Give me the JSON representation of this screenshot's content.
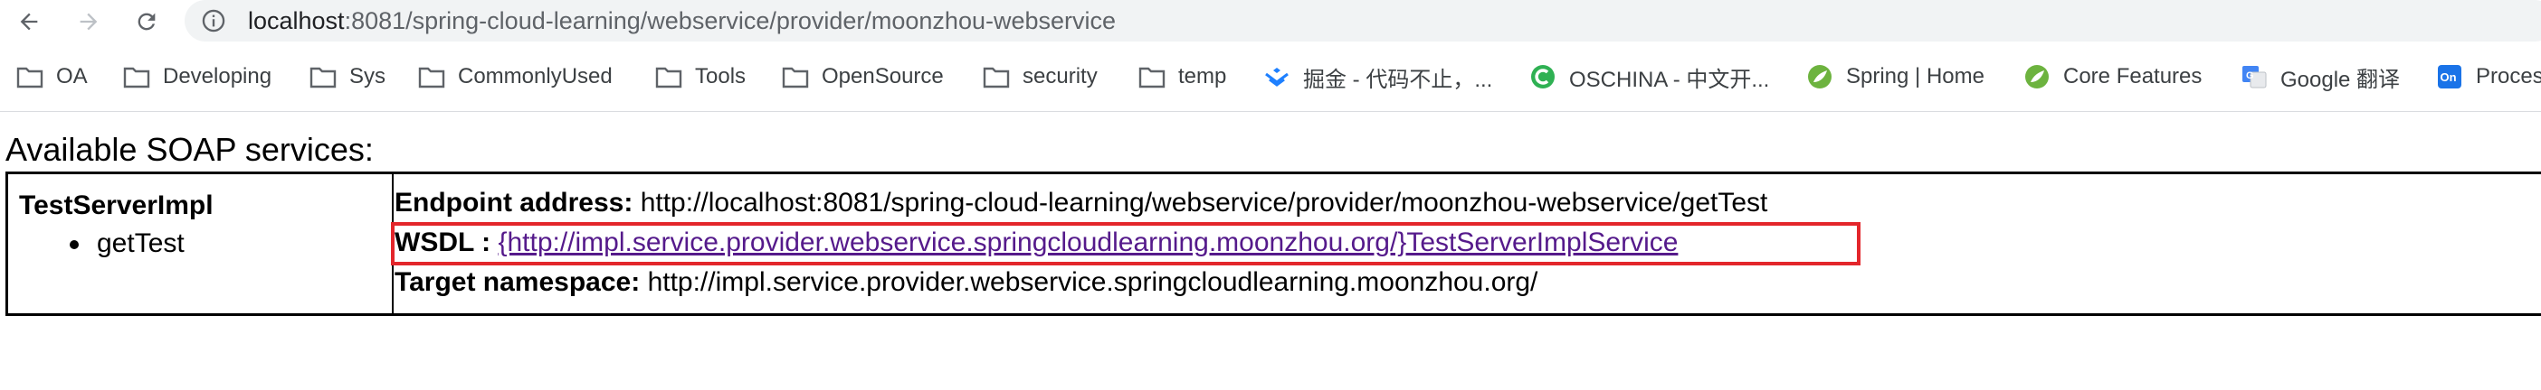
{
  "browser": {
    "url_host": "localhost",
    "url_path": ":8081/spring-cloud-learning/webservice/provider/moonzhou-webservice",
    "nav": {
      "back_icon": "arrow-left-icon",
      "forward_icon": "arrow-right-icon",
      "reload_icon": "reload-icon",
      "info_icon": "info-icon"
    },
    "bookmarks": [
      {
        "label": "OA",
        "icon": "folder-icon"
      },
      {
        "label": "Developing",
        "icon": "folder-icon"
      },
      {
        "label": "Sys",
        "icon": "folder-icon"
      },
      {
        "label": "CommonlyUsed",
        "icon": "folder-icon"
      },
      {
        "label": "Tools",
        "icon": "folder-icon"
      },
      {
        "label": "OpenSource",
        "icon": "folder-icon"
      },
      {
        "label": "security",
        "icon": "folder-icon"
      },
      {
        "label": "temp",
        "icon": "folder-icon"
      },
      {
        "label": "掘金 - 代码不止，...",
        "icon": "juejin-icon"
      },
      {
        "label": "OSCHINA - 中文开...",
        "icon": "oschina-icon"
      },
      {
        "label": "Spring | Home",
        "icon": "spring-icon"
      },
      {
        "label": "Core Features",
        "icon": "spring-icon"
      },
      {
        "label": "Google 翻译",
        "icon": "google-translate-icon"
      },
      {
        "label": "Proces",
        "icon": "on-icon"
      }
    ]
  },
  "page": {
    "heading": "Available SOAP services:",
    "service": {
      "name": "TestServerImpl",
      "operations": [
        "getTest"
      ],
      "endpoint_label": "Endpoint address:",
      "endpoint_value": "http://localhost:8081/spring-cloud-learning/webservice/provider/moonzhou-webservice/getTest",
      "wsdl_label": "WSDL :",
      "wsdl_value": "{http://impl.service.provider.webservice.springcloudlearning.moonzhou.org/}TestServerImplService",
      "namespace_label": "Target namespace:",
      "namespace_value": "http://impl.service.provider.webservice.springcloudlearning.moonzhou.org/"
    }
  },
  "colors": {
    "highlight": "#e3262b",
    "link_visited": "#551a8b",
    "omnibox_bg": "#f1f3f4"
  }
}
